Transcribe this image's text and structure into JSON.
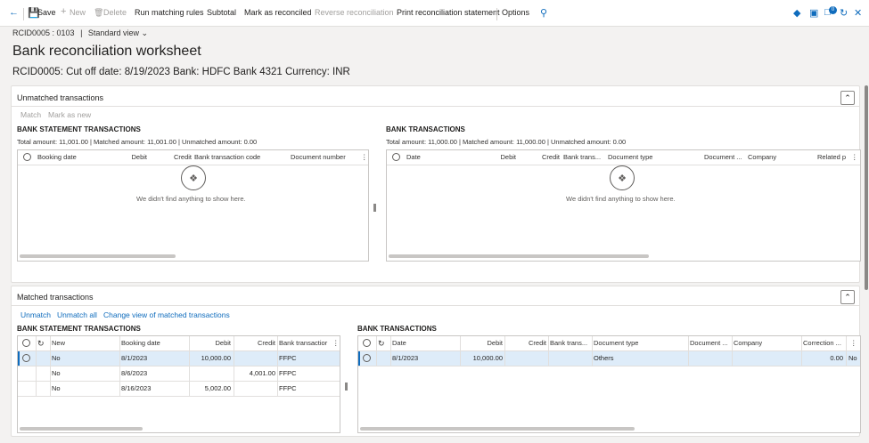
{
  "toolbar": {
    "save": "Save",
    "new": "New",
    "delete": "Delete",
    "run_matching_rules": "Run matching rules",
    "subtotal": "Subtotal",
    "mark_as_reconciled": "Mark as reconciled",
    "reverse_reconciliation": "Reverse reconciliation",
    "print_statement": "Print reconciliation statement",
    "options": "Options",
    "badge": "0"
  },
  "header": {
    "breadcrumb_id": "RCID0005 : 0103",
    "view": "Standard view",
    "title": "Bank reconciliation worksheet",
    "subtitle": "RCID0005: Cut off date: 8/19/2023 Bank: HDFC Bank 4321 Currency: INR"
  },
  "unmatched": {
    "title": "Unmatched transactions",
    "actions": {
      "match": "Match",
      "mark_as_new": "Mark as new"
    },
    "bank_statement": {
      "title": "BANK STATEMENT TRANSACTIONS",
      "totals": "Total amount: 11,001.00 | Matched amount: 11,001.00 | Unmatched amount: 0.00",
      "columns": [
        "Booking date",
        "Debit",
        "Credit",
        "Bank transaction code",
        "Document number"
      ],
      "empty": "We didn't find anything to show here."
    },
    "bank_transactions": {
      "title": "BANK TRANSACTIONS",
      "totals": "Total amount: 11,000.00 | Matched amount: 11,000.00 | Unmatched amount: 0.00",
      "columns": [
        "Date",
        "Debit",
        "Credit",
        "Bank trans...",
        "Document type",
        "Document ...",
        "Company",
        "Related p"
      ],
      "empty": "We didn't find anything to show here."
    }
  },
  "matched": {
    "title": "Matched transactions",
    "actions": {
      "unmatch": "Unmatch",
      "unmatch_all": "Unmatch all",
      "change_view": "Change view of matched transactions"
    },
    "bank_statement": {
      "title": "BANK STATEMENT TRANSACTIONS",
      "columns": [
        "New",
        "Booking date",
        "Debit",
        "Credit",
        "Bank transactior"
      ],
      "rows": [
        {
          "new": "No",
          "booking_date": "8/1/2023",
          "debit": "10,000.00",
          "credit": "",
          "code": "FFPC"
        },
        {
          "new": "No",
          "booking_date": "8/6/2023",
          "debit": "",
          "credit": "4,001.00",
          "code": "FFPC"
        },
        {
          "new": "No",
          "booking_date": "8/16/2023",
          "debit": "5,002.00",
          "credit": "",
          "code": "FFPC"
        }
      ]
    },
    "bank_transactions": {
      "title": "BANK TRANSACTIONS",
      "columns": [
        "Date",
        "Debit",
        "Credit",
        "Bank trans...",
        "Document type",
        "Document ...",
        "Company",
        "Correction ..."
      ],
      "rows": [
        {
          "date": "8/1/2023",
          "debit": "10,000.00",
          "credit": "",
          "bank_trans": "",
          "doc_type": "Others",
          "doc": "",
          "company": "",
          "correction": "0.00",
          "extra": "No"
        }
      ]
    }
  }
}
